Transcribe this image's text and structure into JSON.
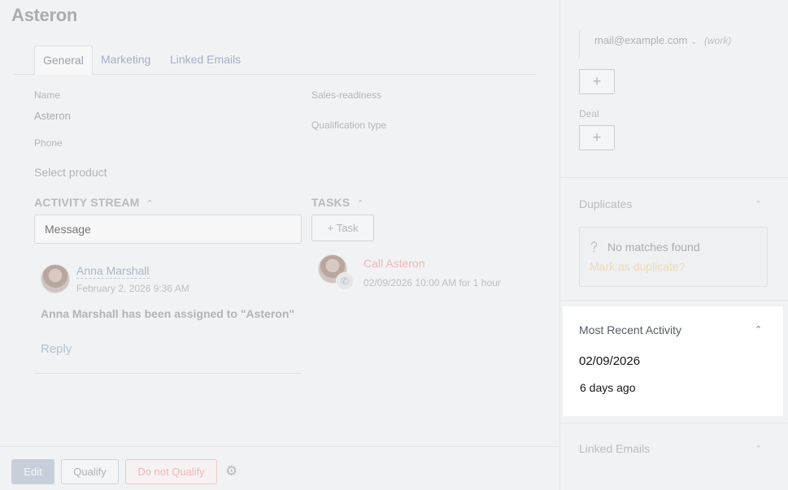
{
  "header": {
    "title": "Asteron",
    "icons": [
      "bell-icon",
      "document-icon",
      "expand-icon"
    ]
  },
  "tabs": [
    {
      "label": "General",
      "active": true
    },
    {
      "label": "Marketing",
      "active": false
    },
    {
      "label": "Linked Emails",
      "active": false
    }
  ],
  "fields": {
    "name_label": "Name",
    "name_value": "Asteron",
    "phone_label": "Phone",
    "sales_readiness_label": "Sales-readiness",
    "qualification_type_label": "Qualification type",
    "select_product": "Select product"
  },
  "activity_stream": {
    "heading": "ACTIVITY STREAM",
    "message_placeholder": "Message",
    "entry": {
      "author": "Anna Marshall",
      "timestamp": "February 2, 2026 9:36 AM",
      "text": "Anna Marshall has been assigned to \"Asteron\"",
      "reply_label": "Reply"
    }
  },
  "tasks": {
    "heading": "TASKS",
    "add_label": "Task",
    "entry": {
      "title": "Call Asteron",
      "when": "02/09/2026 10:00 AM for 1 hour"
    }
  },
  "footer": {
    "edit_label": "Edit",
    "qualify_label": "Qualify",
    "do_not_qualify_label": "Do not Qualify"
  },
  "sidebar": {
    "email_value": "mail@example.com",
    "email_type": "(work)",
    "add_symbol": "+",
    "deal_label": "Deal",
    "duplicates": {
      "title": "Duplicates",
      "no_matches": "No matches found",
      "mark_link": "Mark as duplicate?"
    },
    "most_recent_activity": {
      "title": "Most Recent Activity",
      "date": "02/09/2026",
      "ago": "6 days ago"
    },
    "linked_emails_title": "Linked Emails"
  },
  "colors": {
    "accent_link": "#a9b6ca",
    "danger_link": "#f0b7ba",
    "panel_bg": "#f1f2f3",
    "card_bg": "#ffffff"
  }
}
